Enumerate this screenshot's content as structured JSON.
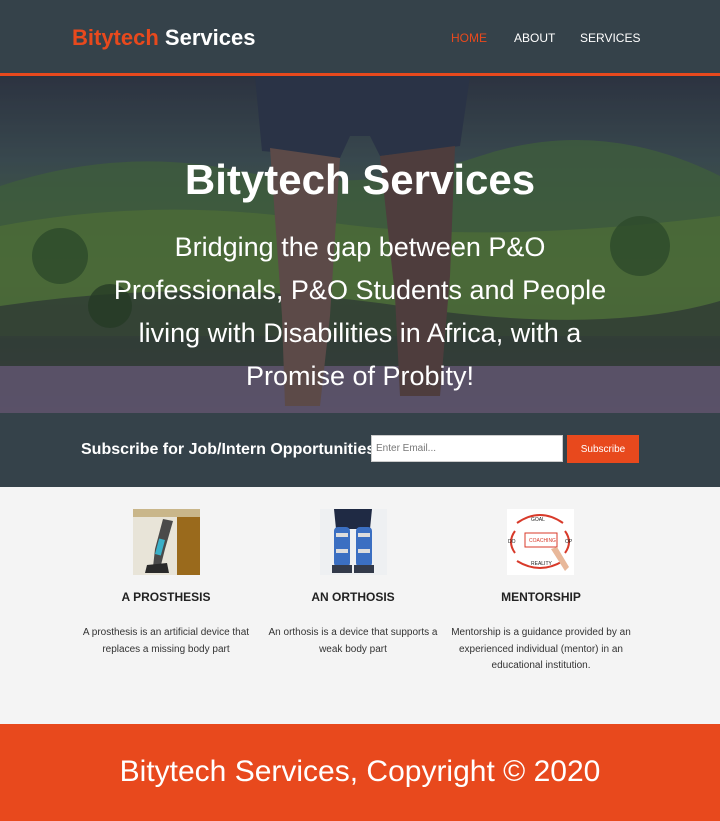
{
  "header": {
    "brand_highlight": "Bitytech",
    "brand_rest": " Services",
    "nav": [
      {
        "label": "HOME",
        "active": true
      },
      {
        "label": "ABOUT",
        "active": false
      },
      {
        "label": "SERVICES",
        "active": false
      }
    ]
  },
  "hero": {
    "title": "Bitytech Services",
    "subtitle": "Bridging the gap between P&O Professionals, P&O Students and People living with Disabilities in Africa, with a Promise of Probity!"
  },
  "newsletter": {
    "label": "Subscribe for Job/Intern Opportunities",
    "placeholder": "Enter Email...",
    "button": "Subscribe"
  },
  "boxes": [
    {
      "title": "A PROSTHESIS",
      "text": "A prosthesis is an artificial device that replaces a missing body part"
    },
    {
      "title": "AN ORTHOSIS",
      "text": "An orthosis is a device that supports a weak body part"
    },
    {
      "title": "MENTORSHIP",
      "text": "Mentorship is a guidance provided by an experienced individual (mentor) in an educational institution."
    }
  ],
  "coaching_image": {
    "goal": "GOAL",
    "coaching": "COACHING",
    "do": "DO",
    "op": "OP",
    "reality": "REALITY"
  },
  "footer": {
    "text": "Bitytech Services, Copyright © 2020"
  },
  "colors": {
    "accent": "#e8491d",
    "dark": "#35424a",
    "light_bg": "#f4f4f4"
  }
}
